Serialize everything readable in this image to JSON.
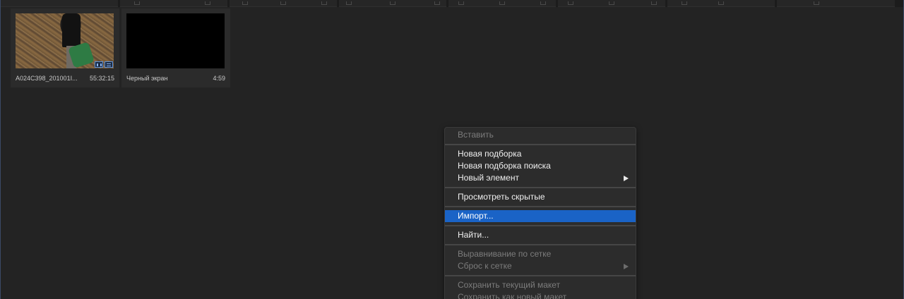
{
  "bins": [
    {
      "name": "A024C398_201001I...",
      "duration": "55:32:15",
      "thumbnail": "forest-footage",
      "badge_icons": [
        "video-bars-icon",
        "audio-arrows-icon"
      ]
    },
    {
      "name": "Черный экран",
      "duration": "4:59",
      "thumbnail": "black-frame"
    }
  ],
  "context_menu": {
    "paste": "Вставить",
    "new_bin": "Новая подборка",
    "new_search_bin": "Новая подборка поиска",
    "new_item": "Новый элемент",
    "view_hidden": "Просмотреть скрытые",
    "import": "Импорт...",
    "find": "Найти...",
    "align_to_grid": "Выравнивание по сетке",
    "reset_to_grid": "Сброс к сетке",
    "save_current_layout": "Сохранить текущий макет",
    "save_as_new_layout": "Сохранить как новый макет"
  },
  "colors": {
    "highlight": "#1a63c6",
    "panel_bg": "#232323",
    "menu_bg": "#2c2c2c",
    "disabled_text": "#7c7c7c"
  }
}
